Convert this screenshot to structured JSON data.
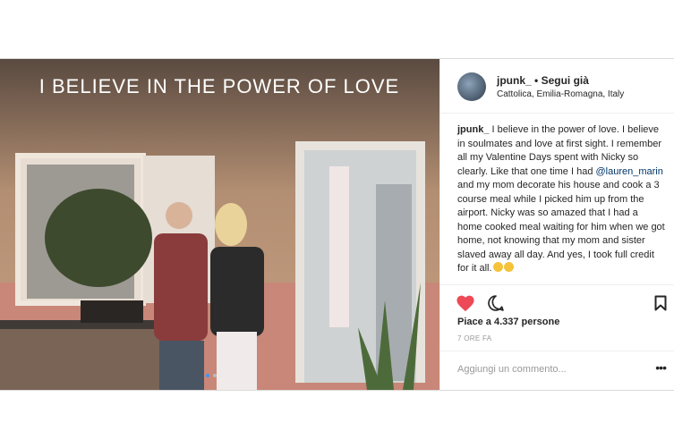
{
  "post": {
    "username": "jpunk_",
    "follow_status": "Segui già",
    "location": "Cattolica, Emilia-Romagna, Italy",
    "neon_sign": "I BELIEVE IN THE POWER OF LOVE",
    "caption": {
      "username": "jpunk_",
      "text_before": " I believe in the power of love. I believe in soulmates and love at first sight. I remember all my Valentine Days spent with Nicky so clearly. Like that one time I had ",
      "mention": "@lauren_marin",
      "text_after": " and my mom decorate his house and cook a 3 course meal while I picked him up from the airport. Nicky was so amazed that I had a home cooked meal waiting for him when we got home, not knowing that my mom and sister slaved away all day. And yes, I took full credit for it all."
    },
    "likes": "Piace a 4.337 persone",
    "time": "7 ORE FA",
    "comment_placeholder": "Aggiungi un commento...",
    "more_label": "•••",
    "accent": "#ed4956"
  }
}
